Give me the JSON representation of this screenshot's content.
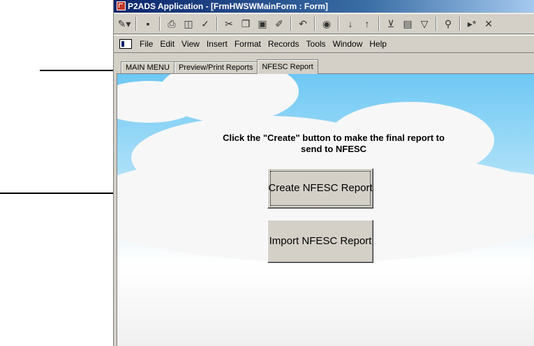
{
  "window": {
    "title": "P2ADS Application - [FrmHWSWMainForm : Form]"
  },
  "menu": {
    "items": [
      "File",
      "Edit",
      "View",
      "Insert",
      "Format",
      "Records",
      "Tools",
      "Window",
      "Help"
    ]
  },
  "tabs": [
    {
      "label": "MAIN MENU",
      "active": false
    },
    {
      "label": "Preview/Print Reports",
      "active": false
    },
    {
      "label": "NFESC Report",
      "active": true
    }
  ],
  "main": {
    "instruction": "Click the \"Create\" button to make the final report to send to NFESC",
    "create_button": "Create NFESC Report",
    "import_button": "Import NFESC Report"
  },
  "toolbar_icons": [
    "design-view-icon",
    "save-icon",
    "print-icon",
    "print-preview-icon",
    "spelling-icon",
    "cut-icon",
    "copy-icon",
    "paste-icon",
    "format-painter-icon",
    "undo-icon",
    "hyperlink-icon",
    "sort-ascending-icon",
    "sort-descending-icon",
    "filter-by-selection-icon",
    "filter-by-form-icon",
    "apply-filter-icon",
    "find-icon",
    "new-record-icon",
    "delete-record-icon"
  ],
  "colors": {
    "titlebar": "#0a246a",
    "sky": "#6ec8f4",
    "face": "#d4d0c8"
  }
}
